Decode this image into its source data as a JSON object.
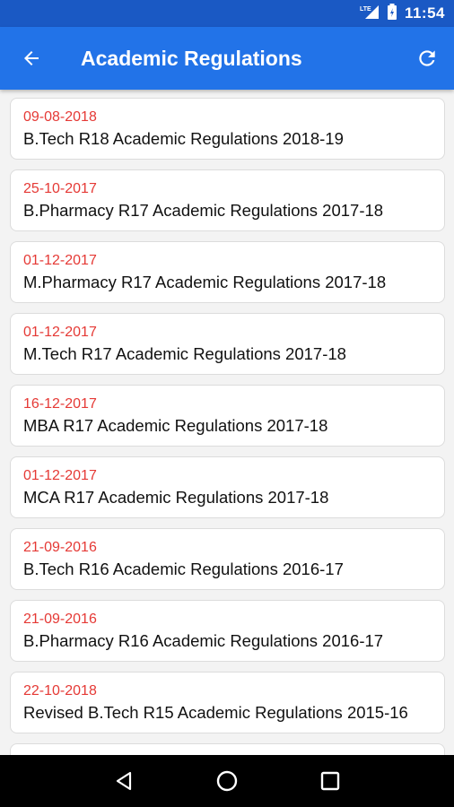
{
  "status_bar": {
    "time": "11:54",
    "icons": [
      "lte-signal-icon",
      "battery-icon"
    ]
  },
  "app_bar": {
    "title": "Academic Regulations",
    "back_icon": "arrow-back-icon",
    "refresh_icon": "refresh-icon"
  },
  "items": [
    {
      "date": "09-08-2018",
      "title": "B.Tech R18 Academic Regulations 2018-19"
    },
    {
      "date": "25-10-2017",
      "title": "B.Pharmacy R17 Academic Regulations 2017-18"
    },
    {
      "date": "01-12-2017",
      "title": "M.Pharmacy R17 Academic Regulations 2017-18"
    },
    {
      "date": "01-12-2017",
      "title": "M.Tech R17 Academic Regulations 2017-18"
    },
    {
      "date": "16-12-2017",
      "title": "MBA R17 Academic Regulations 2017-18"
    },
    {
      "date": "01-12-2017",
      "title": "MCA R17 Academic Regulations 2017-18"
    },
    {
      "date": "21-09-2016",
      "title": "B.Tech R16 Academic Regulations 2016-17"
    },
    {
      "date": "21-09-2016",
      "title": "B.Pharmacy R16 Academic Regulations 2016-17"
    },
    {
      "date": "22-10-2018",
      "title": "Revised B.Tech R15 Academic Regulations 2015-16"
    }
  ],
  "nav_bar": {
    "icons": [
      "nav-back-icon",
      "nav-home-icon",
      "nav-recents-icon"
    ]
  },
  "colors": {
    "status_bar": "#1a59c4",
    "app_bar": "#2273e8",
    "date_text": "#e53935"
  }
}
